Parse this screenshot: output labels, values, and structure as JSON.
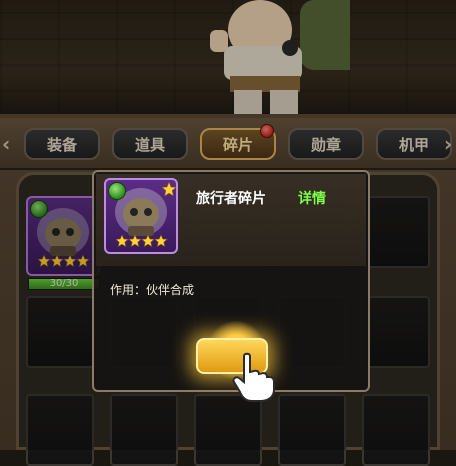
{
  "tabs": [
    {
      "label": "装备"
    },
    {
      "label": "道具"
    },
    {
      "label": "碎片",
      "active": true
    },
    {
      "label": "勋章"
    },
    {
      "label": "机甲"
    }
  ],
  "item_card": {
    "stars": 4,
    "progress_text": "30/30",
    "progress_fraction": 1.0
  },
  "popup": {
    "title": "旅行者碎片",
    "detail_label": "详情",
    "description": "作用：伙伴合成",
    "stars": 4
  },
  "colors": {
    "accent_gold": "#e2b35a",
    "detail_green": "#7cff4a",
    "card_purple": "#5b2d86"
  },
  "icons": {
    "nav_left": "chevron-left-icon",
    "nav_right": "chevron-right-icon",
    "tap_hand": "pointing-hand-icon",
    "new_dot": "notification-dot-icon"
  }
}
